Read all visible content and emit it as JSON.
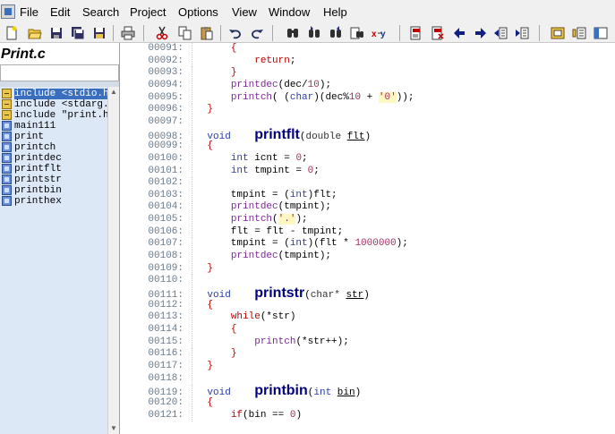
{
  "menu": [
    "File",
    "Edit",
    "Search",
    "Project",
    "Options",
    "View",
    "Window",
    "Help"
  ],
  "toolbar_icons": [
    "new-file-icon",
    "open-folder-icon",
    "save-icon",
    "save-all-icon",
    "save-copy-icon",
    "print-icon",
    "cut-icon",
    "copy-icon",
    "paste-icon",
    "undo-icon",
    "redo-icon",
    "find-icon",
    "find-next-icon",
    "find-prev-icon",
    "find-in-files-icon",
    "replace-icon",
    "bookmark-toggle-icon",
    "bookmark-clear-icon",
    "arrow-left-icon",
    "arrow-right-icon",
    "jump-icon",
    "jump-back-icon",
    "project-icon",
    "build-icon",
    "window-icon"
  ],
  "panel": {
    "title": "Print.c",
    "items": [
      {
        "kind": "include",
        "label": "include <stdio.h",
        "selected": true
      },
      {
        "kind": "include",
        "label": "include <stdarg.h"
      },
      {
        "kind": "include",
        "label": "include \"print.h\""
      },
      {
        "kind": "func",
        "label": "main111"
      },
      {
        "kind": "func",
        "label": "print"
      },
      {
        "kind": "func",
        "label": "printch"
      },
      {
        "kind": "func",
        "label": "printdec"
      },
      {
        "kind": "func",
        "label": "printflt"
      },
      {
        "kind": "func",
        "label": "printstr"
      },
      {
        "kind": "func",
        "label": "printbin"
      },
      {
        "kind": "func",
        "label": "printhex"
      }
    ]
  },
  "code": [
    {
      "n": "00091:",
      "t": [
        {
          "s": "        "
        },
        {
          "s": "{",
          "c": "brace"
        }
      ]
    },
    {
      "n": "00092:",
      "t": [
        {
          "s": "            "
        },
        {
          "s": "return",
          "c": "kw-red"
        },
        {
          "s": ";"
        }
      ]
    },
    {
      "n": "00093:",
      "t": [
        {
          "s": "        "
        },
        {
          "s": "}",
          "c": "brace"
        }
      ]
    },
    {
      "n": "00094:",
      "t": [
        {
          "s": "        "
        },
        {
          "s": "printdec",
          "c": "fn-call"
        },
        {
          "s": "(dec/"
        },
        {
          "s": "10",
          "c": "num"
        },
        {
          "s": ");"
        }
      ]
    },
    {
      "n": "00095:",
      "t": [
        {
          "s": "        "
        },
        {
          "s": "printch",
          "c": "fn-call"
        },
        {
          "s": "( ("
        },
        {
          "s": "char",
          "c": "kw-blue"
        },
        {
          "s": ")(dec%"
        },
        {
          "s": "10",
          "c": "num"
        },
        {
          "s": " + "
        },
        {
          "s": "'0'",
          "c": "str"
        },
        {
          "s": "));"
        }
      ]
    },
    {
      "n": "00096:",
      "t": [
        {
          "s": "    "
        },
        {
          "s": "}",
          "c": "brace"
        }
      ]
    },
    {
      "n": "00097:",
      "t": []
    },
    {
      "n": "00098:",
      "t": [
        {
          "s": "    "
        },
        {
          "s": "void",
          "c": "kw-blue"
        },
        {
          "s": "    "
        },
        {
          "s": "printflt",
          "c": "defn"
        },
        {
          "s": "("
        },
        {
          "s": "double",
          "c": "type-kw"
        },
        {
          "s": " "
        },
        {
          "s": "flt",
          "c": "param-name"
        },
        {
          "s": ")"
        }
      ]
    },
    {
      "n": "00099:",
      "t": [
        {
          "s": "    "
        },
        {
          "s": "{",
          "c": "brace"
        }
      ]
    },
    {
      "n": "00100:",
      "t": [
        {
          "s": "        "
        },
        {
          "s": "int",
          "c": "kw-blue"
        },
        {
          "s": " icnt = "
        },
        {
          "s": "0",
          "c": "num"
        },
        {
          "s": ";"
        }
      ]
    },
    {
      "n": "00101:",
      "t": [
        {
          "s": "        "
        },
        {
          "s": "int",
          "c": "kw-blue"
        },
        {
          "s": " tmpint = "
        },
        {
          "s": "0",
          "c": "num"
        },
        {
          "s": ";"
        }
      ]
    },
    {
      "n": "00102:",
      "t": []
    },
    {
      "n": "00103:",
      "t": [
        {
          "s": "        tmpint = ("
        },
        {
          "s": "int",
          "c": "kw-blue"
        },
        {
          "s": ")flt;"
        }
      ]
    },
    {
      "n": "00104:",
      "t": [
        {
          "s": "        "
        },
        {
          "s": "printdec",
          "c": "fn-call"
        },
        {
          "s": "(tmpint);"
        }
      ]
    },
    {
      "n": "00105:",
      "t": [
        {
          "s": "        "
        },
        {
          "s": "printch",
          "c": "fn-call"
        },
        {
          "s": "("
        },
        {
          "s": "'.'",
          "c": "str"
        },
        {
          "s": ");"
        }
      ]
    },
    {
      "n": "00106:",
      "t": [
        {
          "s": "        flt = flt - tmpint;"
        }
      ]
    },
    {
      "n": "00107:",
      "t": [
        {
          "s": "        tmpint = ("
        },
        {
          "s": "int",
          "c": "kw-blue"
        },
        {
          "s": ")(flt * "
        },
        {
          "s": "1000000",
          "c": "num"
        },
        {
          "s": ");"
        }
      ]
    },
    {
      "n": "00108:",
      "t": [
        {
          "s": "        "
        },
        {
          "s": "printdec",
          "c": "fn-call"
        },
        {
          "s": "(tmpint);"
        }
      ]
    },
    {
      "n": "00109:",
      "t": [
        {
          "s": "    "
        },
        {
          "s": "}",
          "c": "brace"
        }
      ]
    },
    {
      "n": "00110:",
      "t": []
    },
    {
      "n": "00111:",
      "t": [
        {
          "s": "    "
        },
        {
          "s": "void",
          "c": "kw-blue"
        },
        {
          "s": "    "
        },
        {
          "s": "printstr",
          "c": "defn"
        },
        {
          "s": "("
        },
        {
          "s": "char*",
          "c": "type-kw"
        },
        {
          "s": " "
        },
        {
          "s": "str",
          "c": "param-name"
        },
        {
          "s": ")"
        }
      ]
    },
    {
      "n": "00112:",
      "t": [
        {
          "s": "    "
        },
        {
          "s": "{",
          "c": "brace"
        }
      ]
    },
    {
      "n": "00113:",
      "t": [
        {
          "s": "        "
        },
        {
          "s": "while",
          "c": "kw-red"
        },
        {
          "s": "(*str)"
        }
      ]
    },
    {
      "n": "00114:",
      "t": [
        {
          "s": "        "
        },
        {
          "s": "{",
          "c": "brace"
        }
      ]
    },
    {
      "n": "00115:",
      "t": [
        {
          "s": "            "
        },
        {
          "s": "printch",
          "c": "fn-call"
        },
        {
          "s": "(*str++);"
        }
      ]
    },
    {
      "n": "00116:",
      "t": [
        {
          "s": "        "
        },
        {
          "s": "}",
          "c": "brace"
        }
      ]
    },
    {
      "n": "00117:",
      "t": [
        {
          "s": "    "
        },
        {
          "s": "}",
          "c": "brace"
        }
      ]
    },
    {
      "n": "00118:",
      "t": []
    },
    {
      "n": "00119:",
      "t": [
        {
          "s": "    "
        },
        {
          "s": "void",
          "c": "kw-blue"
        },
        {
          "s": "    "
        },
        {
          "s": "printbin",
          "c": "defn"
        },
        {
          "s": "("
        },
        {
          "s": "int",
          "c": "kw-blue"
        },
        {
          "s": " "
        },
        {
          "s": "bin",
          "c": "param-name"
        },
        {
          "s": ")"
        }
      ]
    },
    {
      "n": "00120:",
      "t": [
        {
          "s": "    "
        },
        {
          "s": "{",
          "c": "brace"
        }
      ]
    },
    {
      "n": "00121:",
      "t": [
        {
          "s": "        "
        },
        {
          "s": "if",
          "c": "kw-red"
        },
        {
          "s": "(bin == "
        },
        {
          "s": "0",
          "c": "num"
        },
        {
          "s": ")"
        }
      ]
    }
  ]
}
